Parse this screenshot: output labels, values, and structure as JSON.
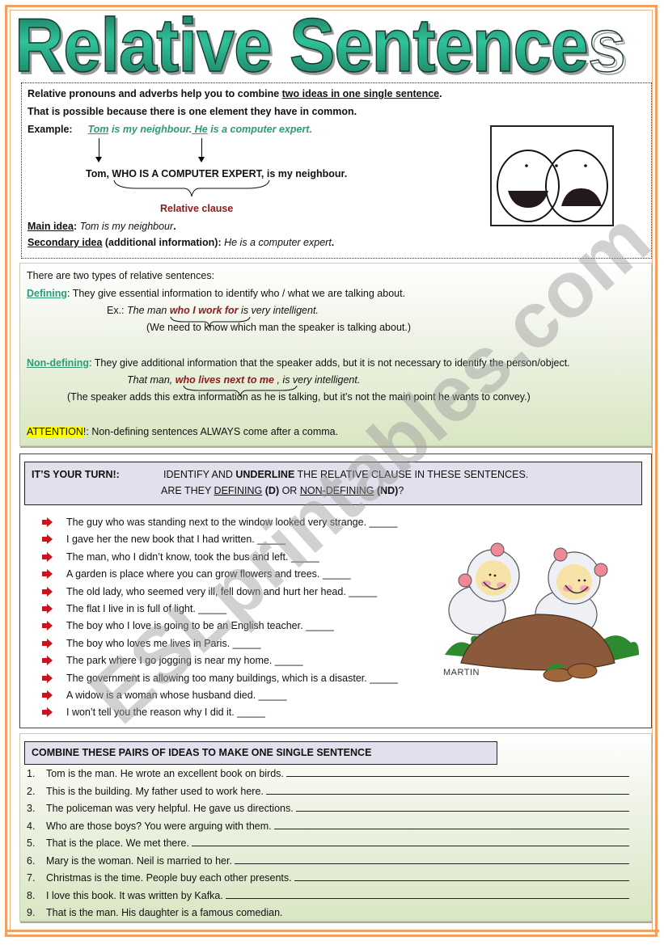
{
  "title": "Relative Sentences",
  "intro": {
    "line1_pre": "Relative pronouns and adverbs help you to combine ",
    "line1_underlined": "two ideas in one single sentence",
    "line1_post": ".",
    "line2": "That is possible because there is one element they have in common.",
    "example_label": "Example:",
    "example_tom": "Tom",
    "example_mid": " is my neighbour.",
    "example_he": " He",
    "example_end": " is a computer expert.",
    "combined_sentence": "Tom, WHO IS A COMPUTER EXPERT, is my neighbour.",
    "relative_clause_label": "Relative clause",
    "main_idea_label": "Main idea",
    "main_idea_text": "Tom is my neighbour",
    "secondary_idea_label": "Secondary idea",
    "secondary_idea_note": " (additional information): ",
    "secondary_idea_text": "He is a computer expert",
    "faces_image": "overlapping-faces-venn-icon"
  },
  "types": {
    "intro": "There are two types  of relative sentences:",
    "defining_label": "Defining",
    "defining_text": ": They give essential information to identify who / what we are talking about.",
    "defining_ex_prefix": "Ex.: ",
    "defining_ex_pre": "The man ",
    "defining_ex_clause": "who I work for",
    "defining_ex_post": " is very intelligent.",
    "defining_note": "(We need to know which man the speaker is talking about.)",
    "nondefining_label": "Non-defining",
    "nondefining_text": ": They give additional information that the speaker adds, but it is not necessary to identify the person/object.",
    "nondefining_ex_pre": "That man, ",
    "nondefining_ex_clause": "who lives next to me",
    "nondefining_ex_post": " , is very intelligent.",
    "nondefining_note": "(The speaker adds this extra information as he is talking, but it’s not the main point he wants to convey.)",
    "attention_label": "ATTENTION",
    "attention_text": "!:  Non-defining sentences ALWAYS come after a comma."
  },
  "your_turn": {
    "label": "IT’S YOUR TURN!:",
    "instr1_pre": "IDENTIFY  AND ",
    "instr1_bold": "UNDERLINE",
    "instr1_post": " THE RELATIVE CLAUSE IN THESE SENTENCES.",
    "instr2_pre": "ARE THEY ",
    "instr2_def": "DEFINING",
    "instr2_d": " (D)",
    "instr2_or": " OR ",
    "instr2_nondef": "NON-DEFINING",
    "instr2_nd": " (ND)",
    "instr2_q": "?",
    "items": [
      "The guy who was standing next to the window looked very strange. _____",
      "I gave her the new book that I had written. _____",
      "The man, who I didn’t know, took the bus and left. _____",
      "A garden is place where you can grow flowers and trees. _____",
      "The old lady, who seemed very ill, fell down and hurt her head. _____",
      "The flat I live in is full of light. _____",
      "The boy who I love is going to be an English teacher. _____",
      "The boy who loves me lives in Paris. _____",
      "The park where I go jogging is near my home. _____",
      "The government is allowing too many buildings, which is a disaster.  _____",
      "A widow is a woman whose husband died. _____",
      "I won’t tell you the reason why I did it. _____"
    ],
    "illustration_caption": "MARTIN"
  },
  "combine": {
    "header": "COMBINE THESE PAIRS OF IDEAS TO MAKE ONE SINGLE SENTENCE",
    "items": [
      {
        "num": "1.",
        "text": "Tom is the man. He wrote an excellent book on birds. "
      },
      {
        "num": "2.",
        "text": "This is the building. My father used to work here. "
      },
      {
        "num": "3.",
        "text": "The policeman was very helpful. He gave us directions. "
      },
      {
        "num": "4.",
        "text": "Who are those boys? You were arguing with them. "
      },
      {
        "num": "5.",
        "text": "That is the place. We met there. "
      },
      {
        "num": "6.",
        "text": "Mary is the woman. Neil is married to her. "
      },
      {
        "num": "7.",
        "text": "Christmas is the time. People buy each other presents. "
      },
      {
        "num": "8.",
        "text": "I love this book. It was written by Kafka. "
      },
      {
        "num": "9.",
        "text": "That is the man. His daughter is a famous comedian."
      }
    ]
  },
  "watermark": "ESLprintables.com",
  "colors": {
    "title_green": "#2fc29a",
    "border_orange": "#f0a060",
    "teal_text": "#2e9a7a",
    "dark_red": "#8b1a1a",
    "panel_lavender": "#e3dfec",
    "highlight_yellow": "#ffff00",
    "bullet_red": "#c8141e"
  }
}
